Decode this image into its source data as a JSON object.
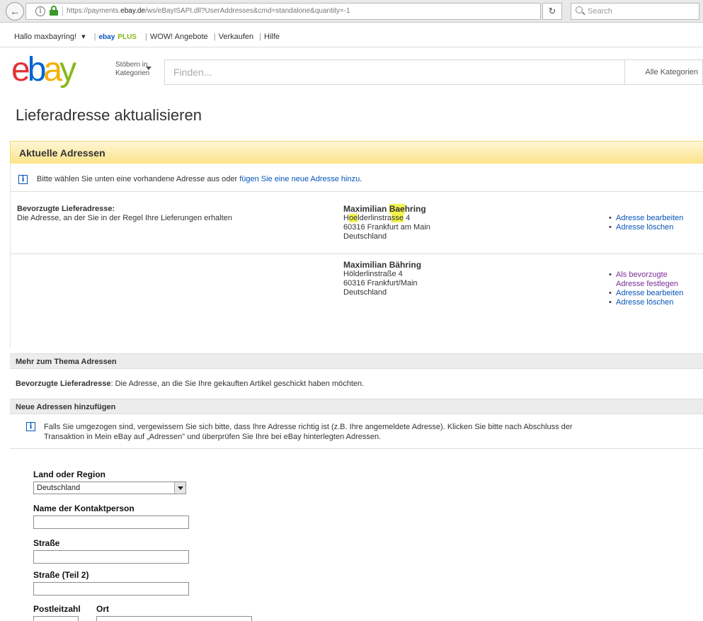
{
  "browser": {
    "url_prefix": "https://payments.",
    "url_domain": "ebay.de",
    "url_suffix": "/ws/eBayISAPI.dll?UserAddresses&cmd=standalone&quantity=-1",
    "search_placeholder": "Search"
  },
  "topnav": {
    "greeting": "Hallo maxbayring!",
    "greeting_caret": "▾",
    "ebay_plus_prefix": "ebay",
    "ebay_plus_suffix": "PLUS",
    "wow": "WOW! Angebote",
    "sell": "Verkaufen",
    "help": "Hilfe"
  },
  "header": {
    "logo_e": "e",
    "logo_b": "b",
    "logo_a": "a",
    "logo_y": "y",
    "browse_line1": "Stöbern in",
    "browse_line2": "Kategorien",
    "search_placeholder": "Finden...",
    "category_select": "Alle Kategorien"
  },
  "page": {
    "title": "Lieferadresse aktualisieren"
  },
  "current": {
    "header": "Aktuelle Adressen",
    "info_prefix": "Bitte wählen Sie unten eine vorhandene Adresse aus oder ",
    "info_link": "fügen Sie eine neue Adresse hinzu",
    "info_suffix": ".",
    "preferred_label": "Bevorzugte Lieferadresse:",
    "preferred_desc": "Die Adresse, an der Sie in der Regel Ihre Lieferungen erhalten",
    "addresses": [
      {
        "name_a": "Maximilian ",
        "name_hl": "Bae",
        "name_b": "hring",
        "street_a": "H",
        "street_hl1": "oe",
        "street_b": "lderlinstra",
        "street_hl2": "sse",
        "street_c": " 4",
        "city": "60316 Frankfurt am Main",
        "country": "Deutschland",
        "actions": [
          "Adresse bearbeiten",
          "Adresse löschen"
        ]
      },
      {
        "name": "Maximilian Bähring",
        "street": "Hölderlinstraße 4",
        "city": "60316 Frankfurt/Main",
        "country": "Deutschland",
        "action_set_line1": "Als bevorzugte",
        "action_set_line2": "Adresse festlegen",
        "actions": [
          "Adresse bearbeiten",
          "Adresse löschen"
        ]
      }
    ]
  },
  "more": {
    "header": "Mehr zum Thema Adressen",
    "term": "Bevorzugte Lieferadresse",
    "definition": ": Die Adresse, an die Sie Ihre gekauften Artikel geschickt haben möchten."
  },
  "new_addresses": {
    "header": "Neue Adressen hinzufügen",
    "info_line1": "Falls Sie umgezogen sind, vergewissern Sie sich bitte, dass Ihre Adresse richtig ist (z.B. Ihre angemeldete Adresse). Klicken Sie bitte nach Abschluss der",
    "info_line2": "Transaktion in Mein eBay auf „Adressen\" und überprüfen Sie Ihre bei eBay hinterlegten Adressen."
  },
  "form": {
    "country_label": "Land oder Region",
    "country_value": "Deutschland",
    "contact_label": "Name der Kontaktperson",
    "street_label": "Straße",
    "street2_label": "Straße (Teil 2)",
    "zip_label": "Postleitzahl",
    "city_label": "Ort"
  },
  "icons": {
    "back": "back-arrow-icon",
    "info": "info-icon",
    "lock": "lock-icon",
    "reload": "reload-icon",
    "search": "search-icon"
  }
}
